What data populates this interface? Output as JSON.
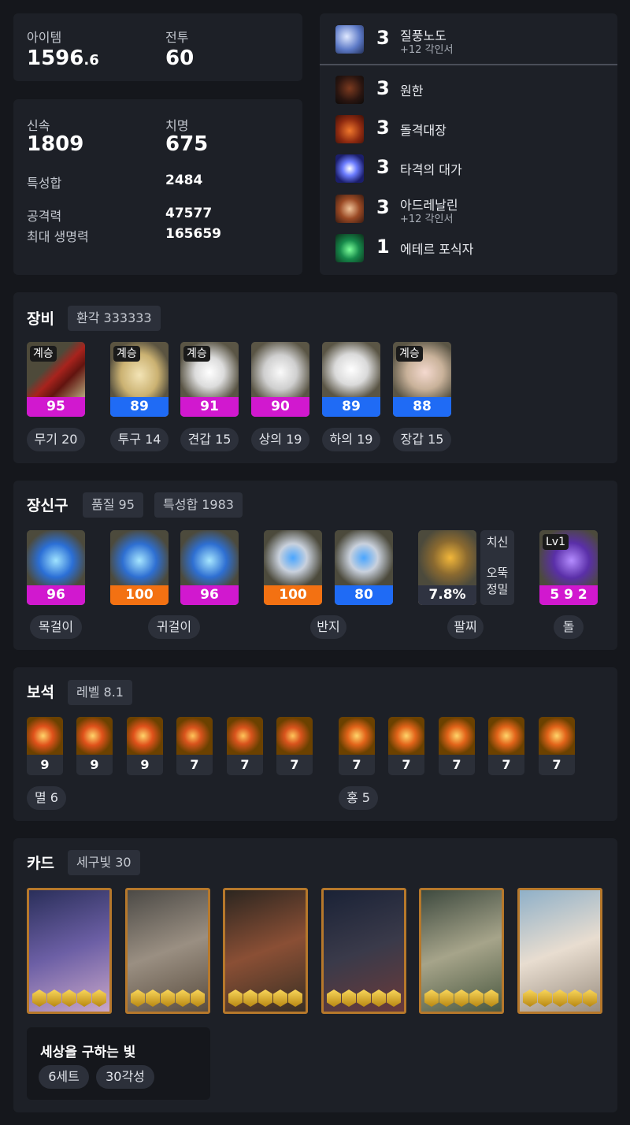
{
  "stats": {
    "item_level_label": "아이템",
    "item_level_int": "1596",
    "item_level_dec": ".6",
    "combat_label": "전투",
    "combat_value": "60",
    "swift_label": "신속",
    "swift_value": "1809",
    "crit_label": "치명",
    "crit_value": "675",
    "total_label": "특성합",
    "total_value": "2484",
    "attack_label": "공격력",
    "attack_value": "47577",
    "hp_label": "최대 생명력",
    "hp_value": "165659"
  },
  "engravings": [
    {
      "level": "3",
      "name": "질풍노도",
      "sub": "+12 각인서",
      "icon": "gale-icon"
    },
    {
      "level": "3",
      "name": "원한",
      "sub": "",
      "icon": "grudge-icon"
    },
    {
      "level": "3",
      "name": "돌격대장",
      "sub": "",
      "icon": "raid-captain-icon"
    },
    {
      "level": "3",
      "name": "타격의 대가",
      "sub": "",
      "icon": "hit-master-icon"
    },
    {
      "level": "3",
      "name": "아드레날린",
      "sub": "+12 각인서",
      "icon": "adrenaline-icon"
    },
    {
      "level": "1",
      "name": "에테르 포식자",
      "sub": "",
      "icon": "ether-predator-icon"
    }
  ],
  "equipment": {
    "title": "장비",
    "chip": "환각 333333",
    "items": [
      {
        "tag": "계승",
        "quality": "95",
        "color": "#d118cf",
        "label": "무기 20",
        "icon": "weapon-icon"
      },
      {
        "tag": "계승",
        "quality": "89",
        "color": "#1f6bf5",
        "label": "투구 14",
        "icon": "helmet-icon"
      },
      {
        "tag": "계승",
        "quality": "91",
        "color": "#d118cf",
        "label": "견갑 15",
        "icon": "shoulder-icon"
      },
      {
        "tag": "",
        "quality": "90",
        "color": "#d118cf",
        "label": "상의 19",
        "icon": "top-icon"
      },
      {
        "tag": "",
        "quality": "89",
        "color": "#1f6bf5",
        "label": "하의 19",
        "icon": "pants-icon"
      },
      {
        "tag": "계승",
        "quality": "88",
        "color": "#1f6bf5",
        "label": "장갑 15",
        "icon": "gloves-icon"
      }
    ]
  },
  "accessories": {
    "title": "장신구",
    "chip_quality": "품질 95",
    "chip_total": "특성합 1983",
    "items": [
      {
        "quality": "96",
        "color": "#d118cf",
        "icon": "necklace-icon"
      },
      {
        "quality": "100",
        "color": "#f37112",
        "icon": "earring-icon"
      },
      {
        "quality": "96",
        "color": "#d118cf",
        "icon": "earring-icon"
      },
      {
        "quality": "100",
        "color": "#f37112",
        "icon": "ring-icon"
      },
      {
        "quality": "80",
        "color": "#1f6bf5",
        "icon": "ring-icon"
      }
    ],
    "bracelet": {
      "value": "7.8%",
      "stat1": "치신",
      "stat2": "오뚝",
      "stat3": "정밀"
    },
    "stone": {
      "level": "Lv1",
      "value": "5 9 2"
    },
    "labels": {
      "necklace": "목걸이",
      "earring": "귀걸이",
      "ring": "반지",
      "bracelet": "팔찌",
      "stone": "돌"
    }
  },
  "gems": {
    "title": "보석",
    "chip": "레벨 8.1",
    "annihilation": [
      "9",
      "9",
      "9",
      "7",
      "7",
      "7"
    ],
    "crimson": [
      "7",
      "7",
      "7",
      "7",
      "7"
    ],
    "annihilation_label": "멸 6",
    "crimson_label": "홍 5"
  },
  "cards": {
    "title": "카드",
    "chip": "세구빛 30",
    "set_name": "세상을 구하는 빛",
    "set_count": "6세트",
    "awakening": "30각성",
    "awakening_per_card": [
      5,
      5,
      5,
      5,
      5,
      5
    ]
  }
}
